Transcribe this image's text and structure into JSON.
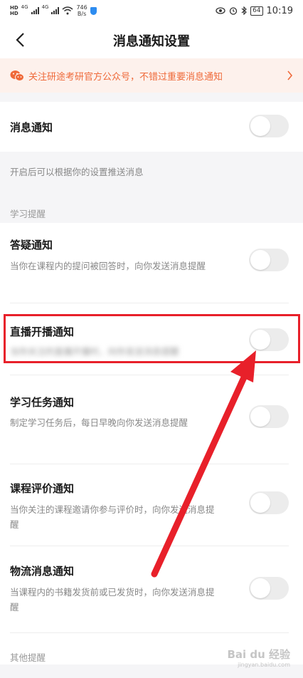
{
  "status_bar": {
    "sim1": "HD",
    "sim2": "HD",
    "net1": "4G",
    "net2": "4G",
    "speed_value": "746",
    "speed_unit": "B/s",
    "battery": "64",
    "time": "10:19"
  },
  "header": {
    "title": "消息通知设置"
  },
  "banner": {
    "text": "关注研途考研官方公众号，不错过重要消息通知"
  },
  "main_toggle": {
    "title": "消息通知",
    "enabled": false,
    "hint": "开启后可以根据你的设置推送消息"
  },
  "sections": {
    "study_label": "学习提醒",
    "other_label": "其他提醒"
  },
  "items": [
    {
      "title": "答疑通知",
      "desc": "当你在课程内的提问被回答时，向你发送消息提醒",
      "enabled": false
    },
    {
      "title": "直播开播通知",
      "desc": "当你关注的直播开播时，向你发送消息提醒",
      "enabled": false
    },
    {
      "title": "学习任务通知",
      "desc": "制定学习任务后，每日早晚向你发送消息提醒",
      "enabled": false
    },
    {
      "title": "课程评价通知",
      "desc": "当你关注的课程邀请你参与评价时，向你发送消息提醒",
      "enabled": false
    },
    {
      "title": "物流消息通知",
      "desc": "当课程内的书籍发货前或已发货时，向你发送消息提醒",
      "enabled": false
    }
  ],
  "watermark": {
    "text": "Bai du 经验",
    "sub": "jingyan.baidu.com"
  },
  "colors": {
    "accent": "#ef6a3a",
    "banner_bg": "#fdf1ec",
    "highlight": "#e8202a",
    "toggle_off": "#ececec"
  }
}
